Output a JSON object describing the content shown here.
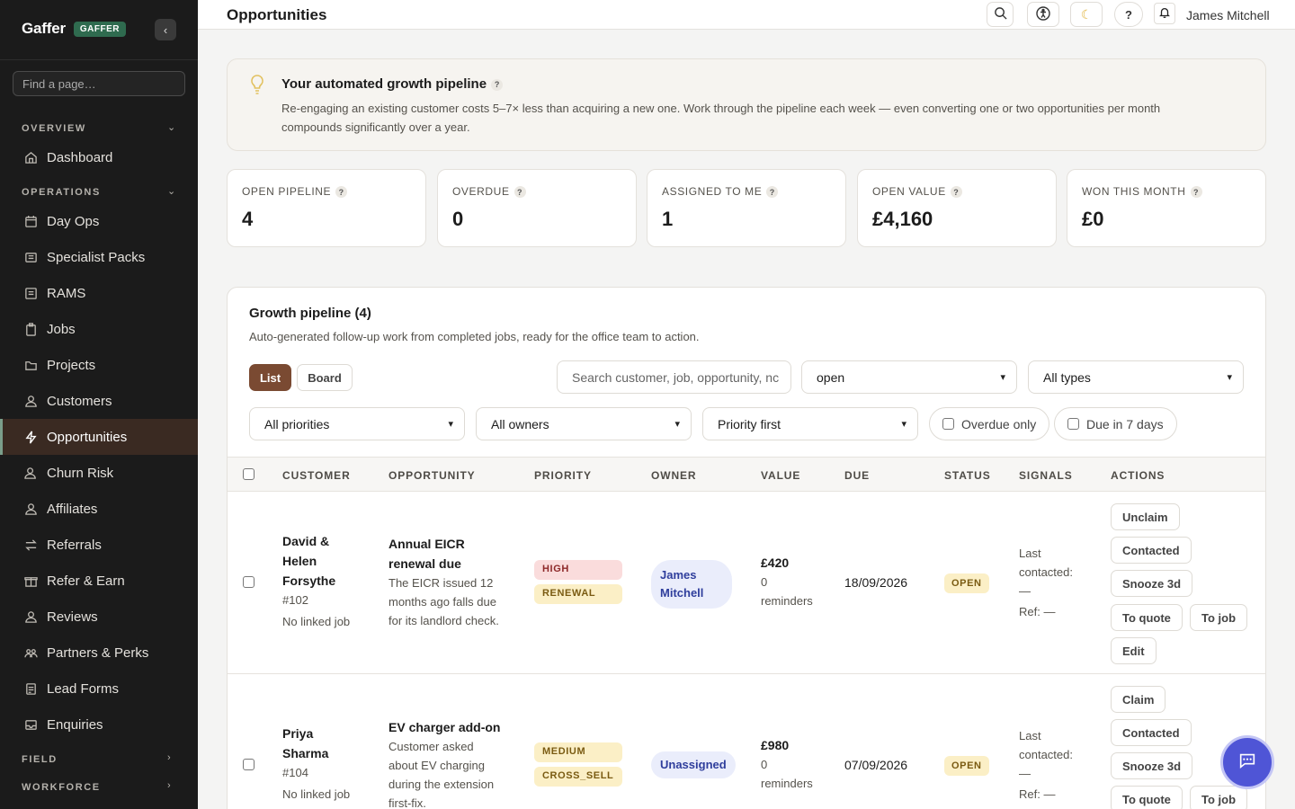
{
  "app": {
    "name": "Gaffer",
    "badge": "GAFFER"
  },
  "sidebar": {
    "search_placeholder": "Find a page…",
    "sections": [
      {
        "label": "OVERVIEW",
        "expanded": true
      },
      {
        "label": "OPERATIONS",
        "expanded": true
      },
      {
        "label": "FIELD",
        "expanded": false
      },
      {
        "label": "WORKFORCE",
        "expanded": false
      }
    ],
    "items": [
      {
        "label": "Dashboard",
        "icon": "home-icon"
      },
      {
        "label": "Day Ops",
        "icon": "calendar-icon"
      },
      {
        "label": "Specialist Packs",
        "icon": "package-icon"
      },
      {
        "label": "RAMS",
        "icon": "document-icon"
      },
      {
        "label": "Jobs",
        "icon": "clipboard-icon"
      },
      {
        "label": "Projects",
        "icon": "folder-icon"
      },
      {
        "label": "Customers",
        "icon": "users-icon"
      },
      {
        "label": "Opportunities",
        "icon": "lightning-icon",
        "active": true
      },
      {
        "label": "Churn Risk",
        "icon": "user-minus-icon"
      },
      {
        "label": "Affiliates",
        "icon": "users-icon"
      },
      {
        "label": "Referrals",
        "icon": "arrows-icon"
      },
      {
        "label": "Refer & Earn",
        "icon": "gift-icon"
      },
      {
        "label": "Reviews",
        "icon": "users-icon"
      },
      {
        "label": "Partners & Perks",
        "icon": "users-group-icon"
      },
      {
        "label": "Lead Forms",
        "icon": "form-icon"
      },
      {
        "label": "Enquiries",
        "icon": "inbox-icon"
      }
    ]
  },
  "topbar": {
    "title": "Opportunities",
    "user_name": "James Mitchell",
    "icons": [
      "search-icon",
      "accessibility-icon",
      "moon-icon",
      "help-icon",
      "bell-icon"
    ]
  },
  "banner": {
    "title": "Your automated growth pipeline",
    "body": "Re-engaging an existing customer costs 5–7× less than acquiring a new one. Work through the pipeline each week — even converting one or two opportunities per month compounds significantly over a year."
  },
  "stats": [
    {
      "label": "OPEN PIPELINE",
      "value": "4"
    },
    {
      "label": "OVERDUE",
      "value": "0"
    },
    {
      "label": "ASSIGNED TO ME",
      "value": "1"
    },
    {
      "label": "OPEN VALUE",
      "value": "£4,160"
    },
    {
      "label": "WON THIS MONTH",
      "value": "£0"
    }
  ],
  "pipeline": {
    "title": "Growth pipeline (4)",
    "subtitle": "Auto-generated follow-up work from completed jobs, ready for the office team to action.",
    "view_list": "List",
    "view_board": "Board",
    "search_placeholder": "Search customer, job, opportunity, nc",
    "status_filter": "open",
    "type_filter": "All types",
    "priority_filter": "All priorities",
    "owner_filter": "All owners",
    "sort": "Priority first",
    "overdue_only": "Overdue only",
    "due_7": "Due in 7 days",
    "columns": [
      "CUSTOMER",
      "OPPORTUNITY",
      "PRIORITY",
      "OWNER",
      "VALUE",
      "DUE",
      "STATUS",
      "SIGNALS",
      "ACTIONS"
    ],
    "rows": [
      {
        "customer_lines": [
          "David &",
          "Helen",
          "Forsythe"
        ],
        "ref": "#102",
        "job": "No linked job",
        "opp_title_lines": [
          "Annual EICR",
          "renewal due"
        ],
        "opp_desc_lines": [
          "The EICR issued 12",
          "months ago falls due",
          "for its landlord check."
        ],
        "priority": "HIGH",
        "type": "RENEWAL",
        "owner_lines": [
          "James",
          "Mitchell"
        ],
        "value": "£420",
        "reminders_lines": [
          "0",
          "reminders"
        ],
        "due": "18/09/2026",
        "status": "OPEN",
        "signal_lines": [
          "Last",
          "contacted:",
          "—",
          "Ref: —"
        ],
        "actions": {
          "claim": "Unclaim",
          "contacted": "Contacted",
          "snooze": "Snooze 3d",
          "to_quote": "To quote",
          "to_job": "To job",
          "edit": "Edit"
        }
      },
      {
        "customer_lines": [
          "Priya",
          "Sharma"
        ],
        "ref": "#104",
        "job": "No linked job",
        "opp_title_lines": [
          "EV charger add-on"
        ],
        "opp_desc_lines": [
          "Customer asked",
          "about EV charging",
          "during the extension",
          "first-fix."
        ],
        "priority": "MEDIUM",
        "type": "CROSS_SELL",
        "owner": "Unassigned",
        "value": "£980",
        "reminders_lines": [
          "0",
          "reminders"
        ],
        "due": "07/09/2026",
        "status": "OPEN",
        "signal_lines": [
          "Last",
          "contacted:",
          "—",
          "Ref: —"
        ],
        "actions": {
          "claim": "Claim",
          "contacted": "Contacted",
          "snooze": "Snooze 3d",
          "to_quote": "To quote",
          "to_job": "To job"
        }
      }
    ]
  },
  "colors": {
    "accent": "#7a4a32",
    "sidebar_bg": "#1b1b1b",
    "fab": "#4f55d6",
    "owner_pill": "#eaedfb"
  }
}
